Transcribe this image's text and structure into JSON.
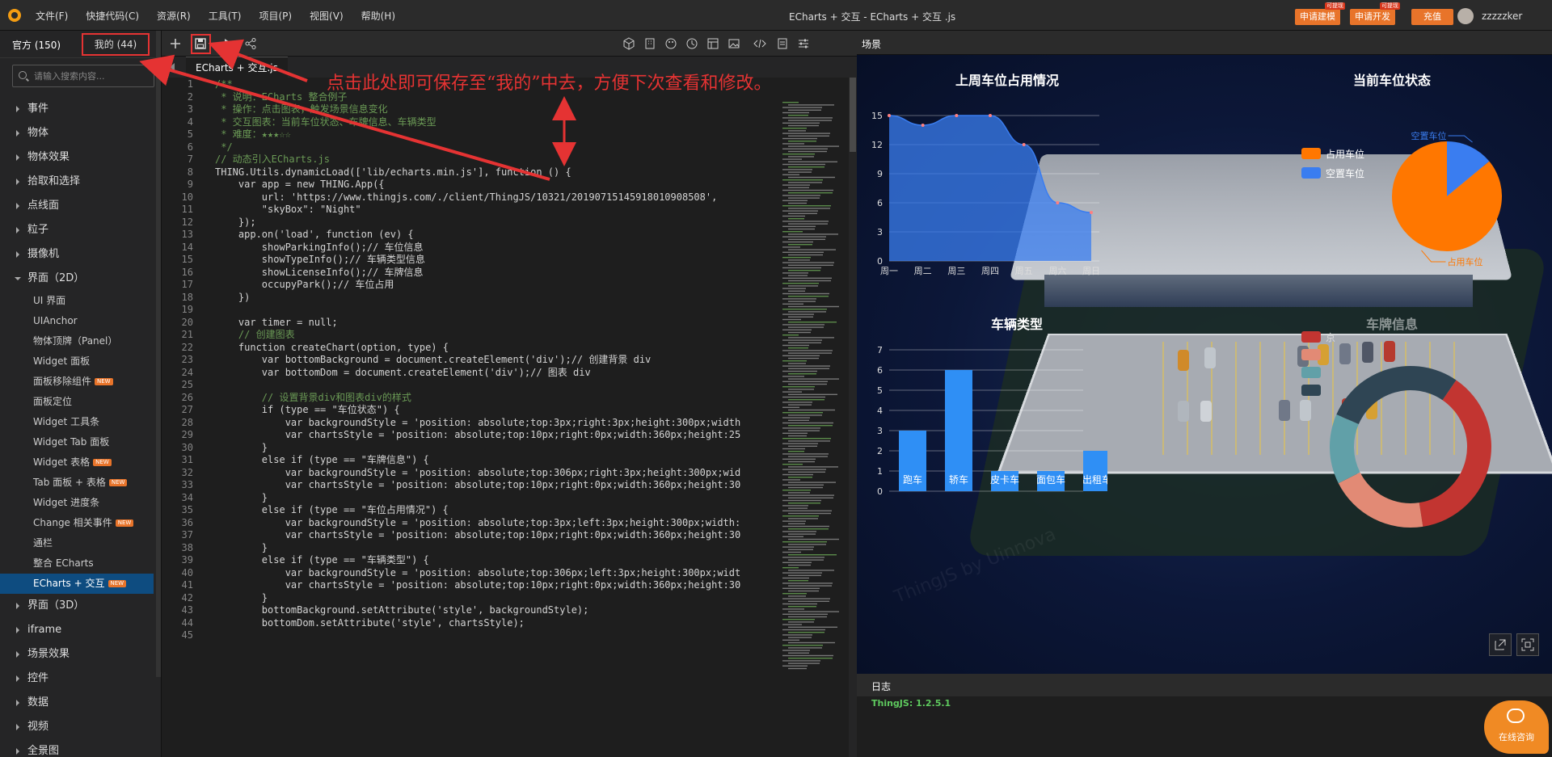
{
  "menu": {
    "items": [
      "文件(F)",
      "快捷代码(C)",
      "资源(R)",
      "工具(T)",
      "项目(P)",
      "视图(V)",
      "帮助(H)"
    ]
  },
  "window_title": "ECharts + 交互  -  ECharts + 交互 .js",
  "top_buttons": {
    "apply_model": "申请建模",
    "apply_dev": "申请开发",
    "recharge": "充值",
    "tag": "可提现"
  },
  "user": {
    "name": "zzzzzker"
  },
  "left_panel": {
    "tab_official": "官方 (150)",
    "tab_mine": "我的 (44)",
    "search_placeholder": "请输入搜索内容...",
    "tree": [
      {
        "label": "事件",
        "open": false
      },
      {
        "label": "物体",
        "open": false
      },
      {
        "label": "物体效果",
        "open": false
      },
      {
        "label": "拾取和选择",
        "open": false
      },
      {
        "label": "点线面",
        "open": false
      },
      {
        "label": "粒子",
        "open": false
      },
      {
        "label": "摄像机",
        "open": false
      },
      {
        "label": "界面（2D）",
        "open": true,
        "children": [
          {
            "label": "UI 界面"
          },
          {
            "label": "UIAnchor"
          },
          {
            "label": "物体顶牌（Panel）"
          },
          {
            "label": "Widget 面板"
          },
          {
            "label": "面板移除组件",
            "tag": "NEW"
          },
          {
            "label": "面板定位"
          },
          {
            "label": "Widget 工具条"
          },
          {
            "label": "Widget Tab 面板"
          },
          {
            "label": "Widget 表格",
            "tag": "NEW"
          },
          {
            "label": "Tab 面板 + 表格",
            "tag": "NEW"
          },
          {
            "label": "Widget 进度条"
          },
          {
            "label": "Change 相关事件",
            "tag": "NEW"
          },
          {
            "label": "通栏"
          },
          {
            "label": "整合 ECharts"
          },
          {
            "label": "ECharts + 交互",
            "tag": "NEW",
            "active": true
          }
        ]
      },
      {
        "label": "界面（3D）",
        "open": false
      },
      {
        "label": "iframe",
        "open": false
      },
      {
        "label": "场景效果",
        "open": false
      },
      {
        "label": "控件",
        "open": false
      },
      {
        "label": "数据",
        "open": false
      },
      {
        "label": "视频",
        "open": false
      },
      {
        "label": "全景图",
        "open": false
      }
    ]
  },
  "editor": {
    "tab": "ECharts + 交互.js",
    "line_numbers": [
      1,
      2,
      3,
      4,
      5,
      6,
      7,
      8,
      9,
      10,
      11,
      12,
      13,
      14,
      15,
      16,
      17,
      18,
      19,
      20,
      21,
      22,
      23,
      24,
      25,
      26,
      27,
      28,
      29,
      30,
      31,
      32,
      33,
      34,
      35,
      36,
      37,
      38,
      39,
      40,
      41,
      42,
      43,
      44,
      45
    ],
    "lines": [
      "/**",
      " * 说明：ECharts 整合例子",
      " * 操作：点击图表，触发场景信息变化",
      " * 交互图表：当前车位状态、车牌信息、车辆类型",
      " * 难度：★★★☆☆",
      " */",
      "// 动态引入ECharts.js",
      "THING.Utils.dynamicLoad(['lib/echarts.min.js'], function () {",
      "    var app = new THING.App({",
      "        url: 'https://www.thingjs.com/./client/ThingJS/10321/20190715145918010908508',",
      "        \"skyBox\": \"Night\"",
      "    });",
      "    app.on('load', function (ev) {",
      "        showParkingInfo();// 车位信息",
      "        showTypeInfo();// 车辆类型信息",
      "        showLicenseInfo();// 车牌信息",
      "        occupyPark();// 车位占用",
      "    })",
      "",
      "    var timer = null;",
      "    // 创建图表",
      "    function createChart(option, type) {",
      "        var bottomBackground = document.createElement('div');// 创建背景 div",
      "        var bottomDom = document.createElement('div');// 图表 div",
      "",
      "        // 设置背景div和图表div的样式",
      "        if (type == \"车位状态\") {",
      "            var backgroundStyle = 'position: absolute;top:3px;right:3px;height:300px;width",
      "            var chartsStyle = 'position: absolute;top:10px;right:0px;width:360px;height:25",
      "        }",
      "        else if (type == \"车牌信息\") {",
      "            var backgroundStyle = 'position: absolute;top:306px;right:3px;height:300px;wid",
      "            var chartsStyle = 'position: absolute;top:10px;right:0px;width:360px;height:30",
      "        }",
      "        else if (type == \"车位占用情况\") {",
      "            var backgroundStyle = 'position: absolute;top:3px;left:3px;height:300px;width:",
      "            var chartsStyle = 'position: absolute;top:10px;right:0px;width:360px;height:30",
      "        }",
      "        else if (type == \"车辆类型\") {",
      "            var backgroundStyle = 'position: absolute;top:306px;left:3px;height:300px;widt",
      "            var chartsStyle = 'position: absolute;top:10px;right:0px;width:360px;height:30",
      "        }",
      "        bottomBackground.setAttribute('style', backgroundStyle);",
      "        bottomDom.setAttribute('style', chartsStyle);",
      ""
    ]
  },
  "scene": {
    "tab": "场景",
    "watermark": "ThingJS by Uinnova",
    "log_tab": "日志",
    "log_line": "ThingJS: 1.2.5.1",
    "consult_label": "在线咨询"
  },
  "annotation": {
    "text": "点击此处即可保存至“我的”中去，方便下次查看和修改。"
  },
  "chart_data": [
    {
      "type": "area",
      "title": "上周车位占用情况",
      "categories": [
        "周一",
        "周二",
        "周三",
        "周四",
        "周五",
        "周六",
        "周日"
      ],
      "values": [
        15,
        14,
        15,
        15,
        12,
        6,
        5
      ],
      "yticks": [
        0,
        3,
        6,
        9,
        12,
        15
      ],
      "ylim": [
        0,
        15
      ],
      "color": "#3a7df0"
    },
    {
      "type": "bar",
      "title": "车辆类型",
      "categories": [
        "跑车",
        "轿车",
        "皮卡车",
        "面包车",
        "出租车"
      ],
      "values": [
        3,
        6,
        1,
        1,
        2
      ],
      "yticks": [
        0,
        1,
        2,
        3,
        4,
        5,
        6,
        7
      ],
      "ylim": [
        0,
        7
      ],
      "color": "#2f8ff5"
    },
    {
      "type": "pie",
      "title": "当前车位状态",
      "legend": [
        "占用车位",
        "空置车位"
      ],
      "labels": [
        "空置车位",
        "占用车位"
      ],
      "values": [
        14,
        86
      ],
      "colors": [
        "#ff7700",
        "#3a7df0"
      ]
    },
    {
      "type": "pie",
      "title": "车牌信息",
      "legend": [
        "京"
      ],
      "values": [
        38,
        20,
        14,
        28
      ],
      "colors": [
        "#c23531",
        "#e28a75",
        "#61a0a8",
        "#2f4554"
      ]
    }
  ]
}
